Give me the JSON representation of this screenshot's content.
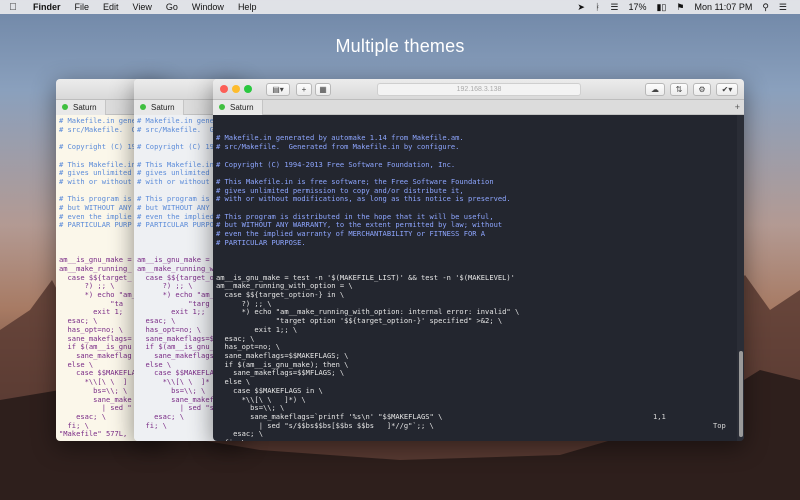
{
  "menubar": {
    "app": "Finder",
    "items": [
      "File",
      "Edit",
      "View",
      "Go",
      "Window",
      "Help"
    ],
    "battery": "17%",
    "clock": "Mon 11:07 PM"
  },
  "headline": "Multiple themes",
  "window": {
    "address": "192.168.3.138",
    "tab_label": "Saturn",
    "status_pos": "1,1",
    "status_top": "Top"
  },
  "back1": {
    "lines": [
      "# Makefile.in gene",
      "# src/Makefile.  G",
      "",
      "# Copyright (C) 19",
      "",
      "# This Makefile.in",
      "# gives unlimited",
      "# with or without",
      "",
      "# This program is",
      "# but WITHOUT ANY",
      "# even the implie",
      "# PARTICULAR PURP",
      "",
      "",
      "",
      "am__is_gnu_make =",
      "am__make_running_",
      "  case $${target_",
      "      ?) ;; \\",
      "      *) echo \"am_",
      "            \"ta",
      "        exit 1;",
      "  esac; \\",
      "  has_opt=no; \\",
      "  sane_makeflags=",
      "  if $(am__is_gnu",
      "    sane_makeflag",
      "  else \\",
      "    case $$MAKEFLA",
      "      *\\\\[\\ \\  ]",
      "        bs=\\\\; \\",
      "        sane_make",
      "          | sed \"",
      "    esac; \\",
      "  fi; \\",
      "\"Makefile\" 577L,"
    ]
  },
  "back2": {
    "lines": [
      "# Makefile.in gener",
      "# src/Makefile.  Ge",
      "",
      "# Copyright (C) 199",
      "",
      "# This Makefile.in",
      "# gives unlimited p",
      "# with or without",
      "",
      "# This program is d",
      "# but WITHOUT ANY W",
      "# even the implied",
      "# PARTICULAR PURPOS",
      "",
      "",
      "",
      "am__is_gnu_make = t",
      "am__make_running_wi",
      "  case $${target_op",
      "      ?) ;; \\",
      "      *) echo \"am__",
      "            \"targ",
      "        exit 1;;",
      "  esac; \\",
      "  has_opt=no; \\",
      "  sane_makeflags=$$",
      "  if $(am__is_gnu_m",
      "    sane_makeflags",
      "  else \\",
      "    case $$MAKEFLAG",
      "      *\\\\[\\ \\  ]*",
      "        bs=\\\\; \\",
      "        sane_makef",
      "          | sed \"s",
      "    esac; \\",
      "  fi; \\"
    ]
  },
  "front": {
    "comment_lines": [
      "# Makefile.in generated by automake 1.14 from Makefile.am.",
      "# src/Makefile.  Generated from Makefile.in by configure.",
      "",
      "# Copyright (C) 1994-2013 Free Software Foundation, Inc.",
      "",
      "# This Makefile.in is free software; the Free Software Foundation",
      "# gives unlimited permission to copy and/or distribute it,",
      "# with or without modifications, as long as this notice is preserved.",
      "",
      "# This program is distributed in the hope that it will be useful,",
      "# but WITHOUT ANY WARRANTY, to the extent permitted by law; without",
      "# even the implied warranty of MERCHANTABILITY or FITNESS FOR A",
      "# PARTICULAR PURPOSE."
    ],
    "code_lines": [
      "am__is_gnu_make = test -n '$(MAKEFILE_LIST)' && test -n '$(MAKELEVEL)'",
      "am__make_running_with_option = \\",
      "  case $${target_option-} in \\",
      "      ?) ;; \\",
      "      *) echo \"am__make_running_with_option: internal error: invalid\" \\",
      "              \"target option '$${target_option-}' specified\" >&2; \\",
      "         exit 1;; \\",
      "  esac; \\",
      "  has_opt=no; \\",
      "  sane_makeflags=$$MAKEFLAGS; \\",
      "  if $(am__is_gnu_make); then \\",
      "    sane_makeflags=$$MFLAGS; \\",
      "  else \\",
      "    case $$MAKEFLAGS in \\",
      "      *\\\\[\\ \\   ]*) \\",
      "        bs=\\\\; \\",
      "        sane_makeflags=`printf '%s\\n' \"$$MAKEFLAGS\" \\",
      "          | sed \"s/$$bs$$bs[$$bs $$bs   ]*//g\"`;; \\",
      "    esac; \\",
      "  fi; \\"
    ]
  }
}
